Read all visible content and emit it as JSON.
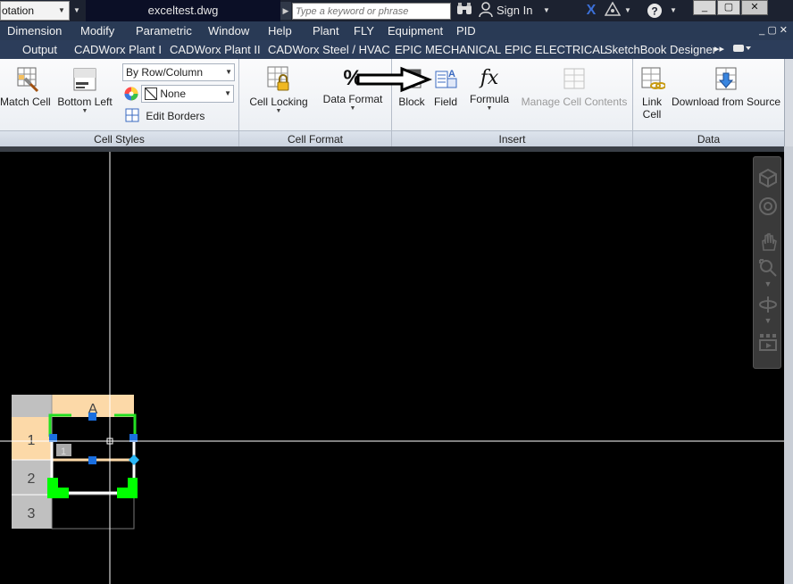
{
  "titlebar": {
    "workspace": "otation",
    "document_title": "exceltest.dwg",
    "search_placeholder": "Type a keyword or phrase",
    "sign_in": "Sign In",
    "icons": [
      "binoculars-icon",
      "user-icon",
      "exchange-x-icon",
      "a360-icon",
      "help-icon"
    ],
    "window_controls": [
      "_",
      "▢",
      "✕"
    ]
  },
  "menubar": {
    "items": [
      "Dimension",
      "Modify",
      "Parametric",
      "Window",
      "Help",
      "Plant",
      "FLY",
      "Equipment",
      "PID"
    ],
    "controls": "_ ▢ ✕"
  },
  "tabs": [
    "Output",
    "CADWorx Plant I",
    "CADWorx Plant II",
    "CADWorx Steel / HVAC",
    "EPIC MECHANICAL",
    "EPIC ELECTRICAL",
    "SketchBook Designer"
  ],
  "tabs_more": "▸▸",
  "ribbon": {
    "cell_styles": {
      "title": "Cell Styles",
      "match_cell": "Match Cell",
      "bottom_left": "Bottom Left",
      "by_row_column": "By Row/Column",
      "none": "None",
      "edit_borders": "Edit Borders"
    },
    "cell_format": {
      "title": "Cell Format",
      "cell_locking": "Cell Locking",
      "data_format": "Data Format",
      "percent_glyph": "%"
    },
    "insert": {
      "title": "Insert",
      "block": "Block",
      "field": "Field",
      "formula": "Formula",
      "formula_glyph": "fx",
      "manage_cell_contents": "Manage Cell Contents"
    },
    "data": {
      "title": "Data",
      "link_cell_line1": "Link",
      "link_cell_line2": "Cell",
      "download_from_source": "Download from Source"
    }
  },
  "table": {
    "column_header": "A",
    "row_headers": [
      "1",
      "2",
      "3"
    ],
    "cell_field_marker": "1"
  },
  "colors": {
    "table_header": "#fcd9a8",
    "grip_green": "#00ff00",
    "grip_blue": "#1a6fe0",
    "menubar": "#293a55",
    "canvas": "#000000"
  }
}
